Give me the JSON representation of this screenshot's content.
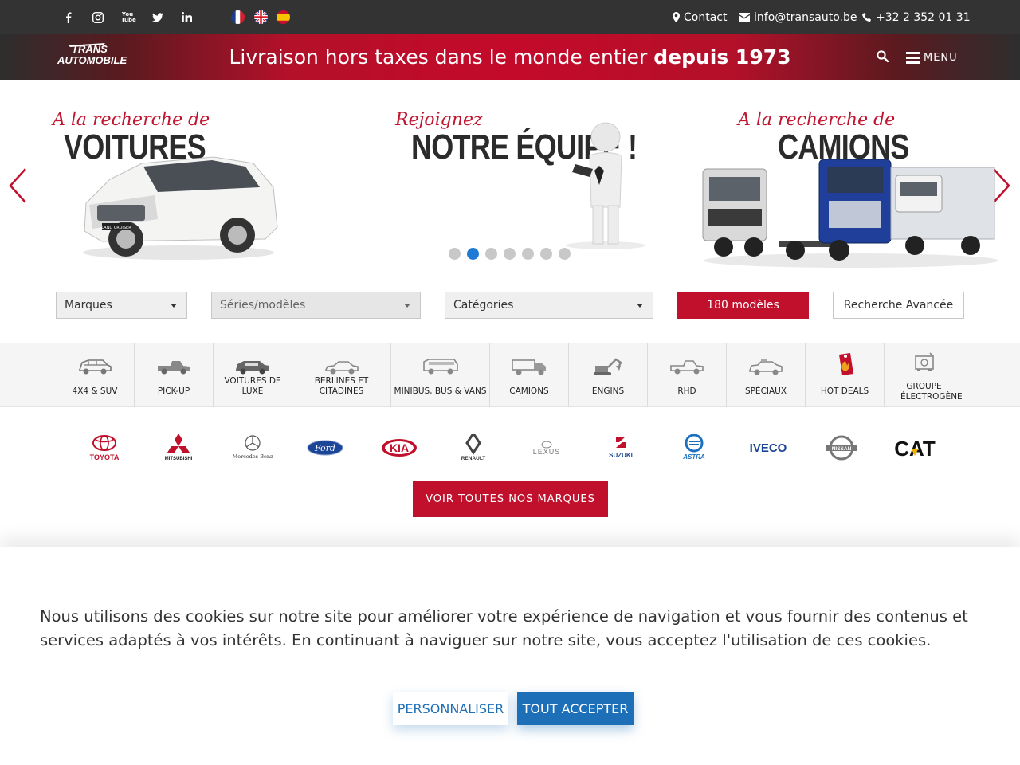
{
  "topbar": {
    "social": [
      "facebook-icon",
      "instagram-icon",
      "youtube-icon",
      "twitter-icon",
      "linkedin-icon"
    ],
    "youtube_text": "You Tube",
    "languages": [
      "fr",
      "en",
      "es"
    ],
    "contact_label": "Contact",
    "email": "info@transauto.be",
    "phone": "+32 2 352 01 31"
  },
  "header": {
    "logo_line1": "TRANS",
    "logo_line2": "AUTOMOBILE",
    "tagline_regular": "Livraison hors taxes dans le monde entier ",
    "tagline_bold": "depuis 1973",
    "menu_label": "MENU"
  },
  "carousel": {
    "slides": [
      {
        "script": "A la recherche de",
        "title": "VOITURES",
        "car_plate": "LAND CRUISER"
      },
      {
        "script": "Rejoignez",
        "title": "NOTRE ÉQUIPE !"
      },
      {
        "script": "A la recherche de",
        "title": "CAMIONS"
      }
    ],
    "dot_count": 7,
    "active_dot": 2
  },
  "filters": {
    "brands_label": "Marques",
    "models_label": "Séries/modèles",
    "categories_label": "Catégories",
    "results_button": "180 modèles",
    "advanced_button": "Recherche Avancée"
  },
  "categories": [
    {
      "label": "4X4 & SUV",
      "icon": "suv-icon"
    },
    {
      "label": "PICK-UP",
      "icon": "pickup-icon"
    },
    {
      "label": "VOITURES DE LUXE",
      "icon": "luxury-car-icon"
    },
    {
      "label": "BERLINES ET CITADINES",
      "icon": "sedan-icon"
    },
    {
      "label": "MINIBUS, BUS & VANS",
      "icon": "minibus-icon"
    },
    {
      "label": "CAMIONS",
      "icon": "truck-icon"
    },
    {
      "label": "ENGINS",
      "icon": "excavator-icon"
    },
    {
      "label": "RHD",
      "icon": "rhd-pickup-icon"
    },
    {
      "label": "SPÉCIAUX",
      "icon": "special-vehicle-icon"
    },
    {
      "label": "HOT DEALS",
      "icon": "hot-deals-icon"
    },
    {
      "label": "GROUPE ÉLECTROGÈNE",
      "icon": "generator-icon"
    }
  ],
  "brands": [
    "TOYOTA",
    "MITSUBISHI",
    "Mercedes-Benz",
    "Ford",
    "KIA",
    "RENAULT",
    "LEXUS",
    "SUZUKI",
    "ASTRA",
    "IVECO",
    "NISSAN",
    "CAT"
  ],
  "brands_button": "VOIR TOUTES NOS MARQUES",
  "cookie": {
    "text": "Nous utilisons des cookies sur notre site pour améliorer votre expérience de navigation et vous fournir des contenus et services adaptés à vos intérêts. En continuant à naviguer sur notre site, vous acceptez l'utilisation de ces cookies.",
    "customize_label": "PERSONNALISER",
    "accept_label": "TOUT ACCEPTER"
  },
  "colors": {
    "brand_red": "#c0102c",
    "topbar": "#333333",
    "accent_blue": "#1d6fb8",
    "active_dot": "#1f7ad6"
  }
}
